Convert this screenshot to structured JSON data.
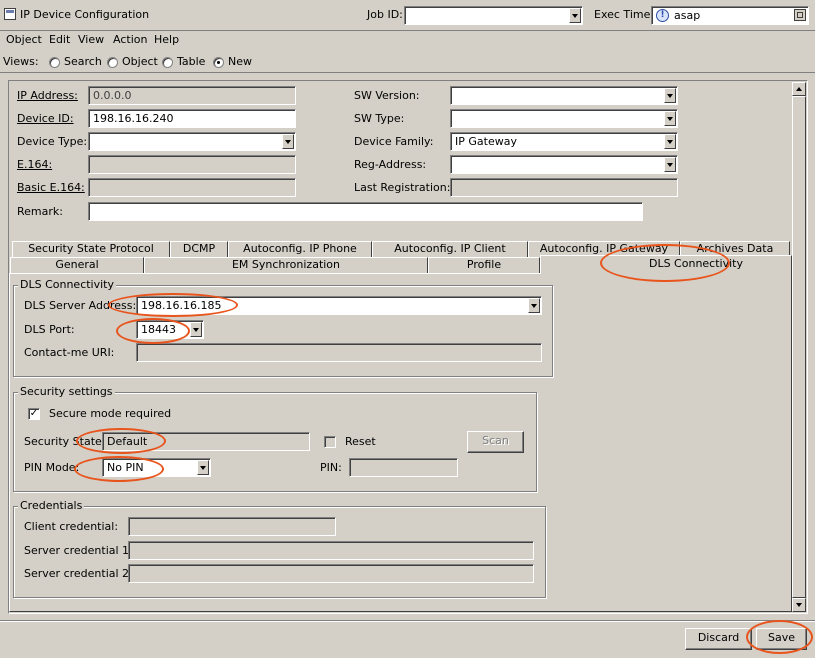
{
  "window": {
    "title": "IP Device Configuration",
    "icon": "window-app-icon"
  },
  "header": {
    "job_id_label": "Job ID:",
    "job_id_value": "",
    "exec_time_label": "Exec Time:",
    "exec_time_value": "asap"
  },
  "menu": [
    "Object",
    "Edit",
    "View",
    "Action",
    "Help"
  ],
  "views": {
    "label": "Views:",
    "options": [
      "Search",
      "Object",
      "Table",
      "New"
    ],
    "selected": "New"
  },
  "device": {
    "ip_address_label": "IP Address:",
    "ip_address_value": "0.0.0.0",
    "device_id_label": "Device ID:",
    "device_id_value": "198.16.16.240",
    "device_type_label": "Device Type:",
    "device_type_value": "",
    "e164_label": "E.164:",
    "e164_value": "",
    "basic_e164_label": "Basic E.164:",
    "basic_e164_value": "",
    "remark_label": "Remark:",
    "remark_value": "",
    "sw_version_label": "SW Version:",
    "sw_version_value": "",
    "sw_type_label": "SW Type:",
    "sw_type_value": "",
    "device_family_label": "Device Family:",
    "device_family_value": "IP Gateway",
    "reg_address_label": "Reg-Address:",
    "reg_address_value": "",
    "last_registration_label": "Last Registration:",
    "last_registration_value": ""
  },
  "tabs_row1": [
    "Security State Protocol",
    "DCMP",
    "Autoconfig. IP Phone",
    "Autoconfig. IP Client",
    "Autoconfig. IP Gateway",
    "Archives Data"
  ],
  "tabs_row2": [
    "General",
    "EM Synchronization",
    "Profile",
    "DLS Connectivity"
  ],
  "active_tab": "DLS Connectivity",
  "dls": {
    "group_title": "DLS Connectivity",
    "server_address_label": "DLS Server Address:",
    "server_address_value": "198.16.16.185",
    "port_label": "DLS Port:",
    "port_value": "18443",
    "contact_uri_label": "Contact-me URI:",
    "contact_uri_value": ""
  },
  "security": {
    "group_title": "Security settings",
    "secure_mode_label": "Secure mode required",
    "secure_mode_checked": true,
    "state_label": "Security State:",
    "state_value": "Default",
    "reset_label": "Reset",
    "reset_checked": false,
    "scan_label": "Scan",
    "pin_mode_label": "PIN Mode:",
    "pin_mode_value": "No PIN",
    "pin_label": "PIN:",
    "pin_value": ""
  },
  "credentials": {
    "group_title": "Credentials",
    "client_label": "Client credential:",
    "client_value": "",
    "server1_label": "Server credential 1:",
    "server1_value": "",
    "server2_label": "Server credential 2:",
    "server2_value": ""
  },
  "footer": {
    "discard_label": "Discard",
    "save_label": "Save"
  },
  "colors": {
    "background": "#d4d0c8",
    "annotation": "#e8541c"
  }
}
